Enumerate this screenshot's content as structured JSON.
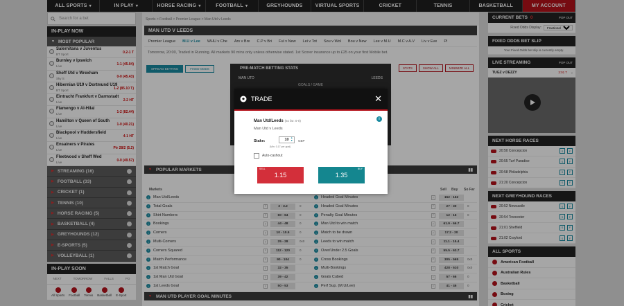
{
  "topnav": [
    {
      "label": "ALL SPORTS",
      "arrow": true
    },
    {
      "label": "IN PLAY",
      "arrow": true
    },
    {
      "label": "HORSE RACING",
      "arrow": true
    },
    {
      "label": "FOOTBALL",
      "arrow": true
    },
    {
      "label": "GREYHOUNDS",
      "arrow": false
    },
    {
      "label": "VIRTUAL SPORTS",
      "arrow": false
    },
    {
      "label": "CRICKET",
      "arrow": false
    },
    {
      "label": "TENNIS",
      "arrow": false
    },
    {
      "label": "BASKETBALL",
      "arrow": false
    },
    {
      "label": "MY ACCOUNT",
      "arrow": false
    }
  ],
  "left": {
    "search_placeholder": "Search for a bet",
    "inplay_title": "IN-PLAY NOW",
    "most_popular": "MOST POPULAR",
    "matches": [
      {
        "name": "Salernitana v Juventus",
        "sub": "BT Sport",
        "odds": "0.2-1 T"
      },
      {
        "name": "Burnley v Ipswich",
        "sub": "Live",
        "odds": "1-1 (45.04)"
      },
      {
        "name": "Sheff Utd v Wrexham",
        "sub": "Sky S",
        "odds": "0-0 (45.43)"
      },
      {
        "name": "Hibernian U19 v Dortmund U19",
        "sub": "BT Sport",
        "odds": "1-2 (85.10 T)"
      },
      {
        "name": "Eintracht Frankfurt v Darmstadt",
        "sub": "Live",
        "odds": "2-2 HT"
      },
      {
        "name": "Flamengo v Al-Hilal",
        "sub": "Live",
        "odds": "1-2 (82.44)"
      },
      {
        "name": "Hamilton v Queen of South",
        "sub": "Live",
        "odds": "1-0 (40.21)"
      },
      {
        "name": "Blackpool v Huddersfield",
        "sub": "Live",
        "odds": "4-1 HT"
      },
      {
        "name": "Ensainers v Pirates",
        "sub": "Live",
        "odds": "Pir 28/2 (5.2)"
      },
      {
        "name": "Fleetwood v Sheff Wed",
        "sub": "Live",
        "odds": "0-0 (49.57)"
      }
    ],
    "categories": [
      "STREAMING (16)",
      "FOOTBALL (33)",
      "CRICKET (1)",
      "TENNIS (10)",
      "HORSE RACING (5)",
      "BASKETBALL (4)",
      "GREYHOUNDS (12)",
      "E-SPORTS (5)",
      "VOLLEYBALL (1)"
    ],
    "soon_title": "IN-PLAY SOON",
    "soon_tabs": [
      "NEXT",
      "TOMORROW",
      "FALLS",
      "PO"
    ],
    "soon_icons": [
      "All Sports",
      "Football",
      "Tennis",
      "Basketball",
      "E-Sport"
    ]
  },
  "center": {
    "breadcrumb": "Sports > Football > Premier League > Man Utd v Leeds",
    "match_title": "MAN UTD V LEEDS",
    "tabs": [
      "Premier League",
      "M.U v Lee",
      "WHU v Che",
      "Ars v Bre",
      "C.P v Bri",
      "Ful v New",
      "Lei v Tot",
      "Sou v Wol",
      "Bou v New",
      "Lee v M.U",
      "M.C v A.V",
      "Liv v Eve",
      "Pl"
    ],
    "ticker": "Tomorrow, 20:00, Traded in Running. All markets 90 mins only unless otherwise stated. 1st Scorer insurance up to £25 on your first Mobile bet.",
    "view_buttons": [
      "SPREAD BETTING",
      "FIXED ODDS"
    ],
    "prematch_title": "PRE-MATCH BETTING STATS",
    "prematch_home": "MAN UTD",
    "prematch_away": "LEEDS",
    "prematch_sub": "GOALS / GAME",
    "stat_buttons": [
      "STATS",
      "SHOW ALL",
      "MINIMIZE ALL"
    ],
    "popular_title": "POPULAR MARKETS",
    "col_markets": "Markets",
    "col_sell": "Sell",
    "col_buy": "Buy",
    "col_sofar": "So Far",
    "rows": [
      {
        "l": "Man Utd/Leeds",
        "lq": "",
        "lsf": "",
        "r": "Headed Goal Minutes",
        "rq": "152 - 162",
        "rsf": ""
      },
      {
        "l": "Total Goals",
        "lq": "3 - 3.2",
        "lsf": "0",
        "r": "Headed Goal Minutes",
        "rq": "27 - 30",
        "rsf": "0"
      },
      {
        "l": "Shirt Numbers",
        "lq": "60 - 64",
        "lsf": "0",
        "r": "Penalty Goal Minutes",
        "rq": "12 - 16",
        "rsf": "0"
      },
      {
        "l": "Bookings",
        "lq": "44 - 48",
        "lsf": "0",
        "r": "Man Utd to win match",
        "rq": "61.9 - 66.7",
        "rsf": ""
      },
      {
        "l": "Corners",
        "lq": "10 - 10.5",
        "lsf": "0",
        "r": "Match to be drawn",
        "rq": "17.2 - 20",
        "rsf": ""
      },
      {
        "l": "Multi-Corners",
        "lq": "25 - 28",
        "lsf": "0x0",
        "r": "Leeds to win match",
        "rq": "11.1 - 15.4",
        "rsf": ""
      },
      {
        "l": "Corners Squared",
        "lq": "112 - 120",
        "lsf": "0",
        "r": "Over/Under 2.5 Goals",
        "rq": "55.5 - 63.7",
        "rsf": ""
      },
      {
        "l": "Match Performance",
        "lq": "90 - 104",
        "lsf": "0",
        "r": "Cross Bookings",
        "rq": "305 - 565",
        "rsf": "0x0"
      },
      {
        "l": "1st Match Goal",
        "lq": "32 - 35",
        "lsf": "",
        "r": "Multi-Bookings",
        "rq": "428 - 510",
        "rsf": "0x0"
      },
      {
        "l": "1st Man Utd Goal",
        "lq": "39 - 42",
        "lsf": "",
        "r": "Goals Cubed",
        "rq": "57 - 66",
        "rsf": "0"
      },
      {
        "l": "1st Leeds Goal",
        "lq": "50 - 53",
        "lsf": "",
        "r": "Perf Sup. (M.U/Lee)",
        "rq": "41 - 46",
        "rsf": "0"
      }
    ],
    "goal_minutes_title": "MAN UTD PLAYER GOAL MINUTES"
  },
  "right": {
    "current_bets": "CURRENT BETS",
    "current_bets_count": "0",
    "popout": "POP OUT",
    "fixed_odds_display": "Fixed Odds Display:",
    "fixed_odds_value": "Fractional",
    "fixed_odds_slip": "FIXED ODDS BET SLIP",
    "slip_empty": "Your Fixed Odds bet slip is currently empty.",
    "live_streaming": "LIVE STREAMING",
    "stream_name": "TUGZ v DEZZY",
    "stream_time": "2:01 T",
    "next_horse": "NEXT HORSE RACES",
    "horse_races": [
      "20:50 Concepcion",
      "20:55 Turf Paradise",
      "20:58 Philadelphia",
      "21:20 Concepcion"
    ],
    "next_grey": "NEXT GREYHOUND RACES",
    "grey_races": [
      "20:52 Newcastle",
      "20:54 Towcester",
      "21:01 Sheffield",
      "21:02 Crayford"
    ],
    "all_sports": "ALL SPORTS",
    "sports": [
      "American Football",
      "Australian Rules",
      "Basketball",
      "Boxing",
      "Cricket"
    ]
  },
  "modal": {
    "title": "TRADE",
    "market": "Man Utd/Leeds",
    "so_far": "(so far: 0-0)",
    "match": "Man Utd v Leeds",
    "stake_label": "Stake:",
    "stake_value": "10",
    "currency": "GBP",
    "min_stake": "(Min: 0.17 per goal)",
    "auto_cashout": "Auto-cashout",
    "sell_tag": "SELL",
    "sell_price": "1.15",
    "buy_tag": "BUY",
    "buy_price": "1.35"
  },
  "colors": {
    "accent": "#b5121b",
    "teal": "#14868f",
    "sell": "#d32f3a"
  }
}
